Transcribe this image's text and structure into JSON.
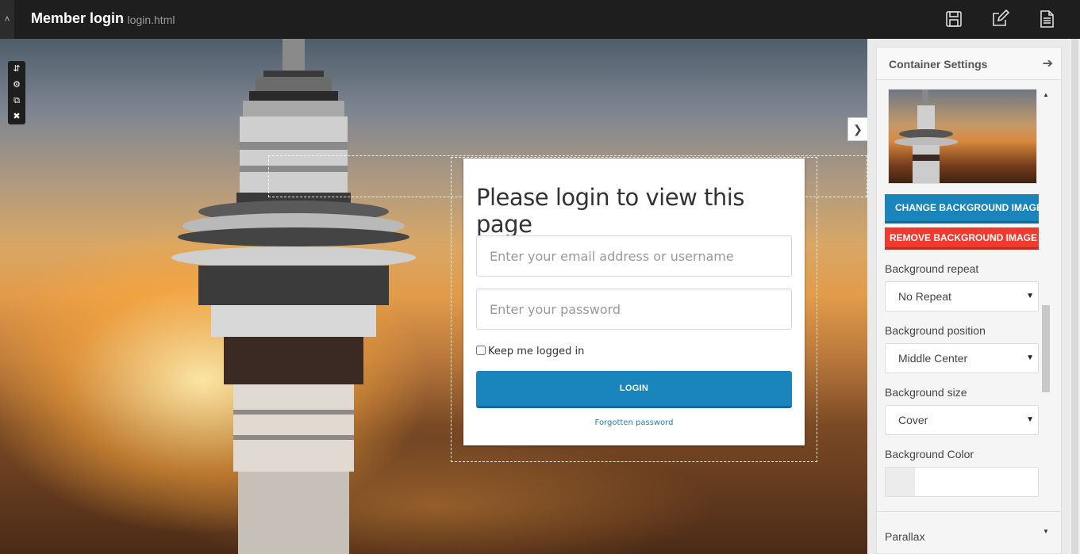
{
  "app": {
    "page_name": "Member login",
    "page_file": "- login.html",
    "toolbar_icons": [
      "save-icon",
      "edit-icon",
      "page-icon"
    ]
  },
  "canvas": {
    "row_toolbar_icons": [
      "move-icon",
      "gear-icon",
      "duplicate-icon",
      "close-icon"
    ],
    "login": {
      "title": "Please login to view this page",
      "email_placeholder": "Enter your email address or username",
      "password_placeholder": "Enter your password",
      "keep_logged_in": "Keep me logged in",
      "login_button": "LOGIN",
      "forgotten_password": "Forgotten password"
    }
  },
  "settings_panel": {
    "title": "Container Settings",
    "change_bg_button": "CHANGE BACKGROUND IMAGE",
    "remove_bg_button": "REMOVE BACKGROUND IMAGE",
    "bg_repeat_label": "Background repeat",
    "bg_repeat_value": "No Repeat",
    "bg_position_label": "Background position",
    "bg_position_value": "Middle Center",
    "bg_size_label": "Background size",
    "bg_size_value": "Cover",
    "bg_color_label": "Background Color",
    "parallax_label": "Parallax"
  },
  "colors": {
    "accent": "#1a85bd",
    "danger": "#f03a2e",
    "topbar": "#1e1e1e"
  }
}
